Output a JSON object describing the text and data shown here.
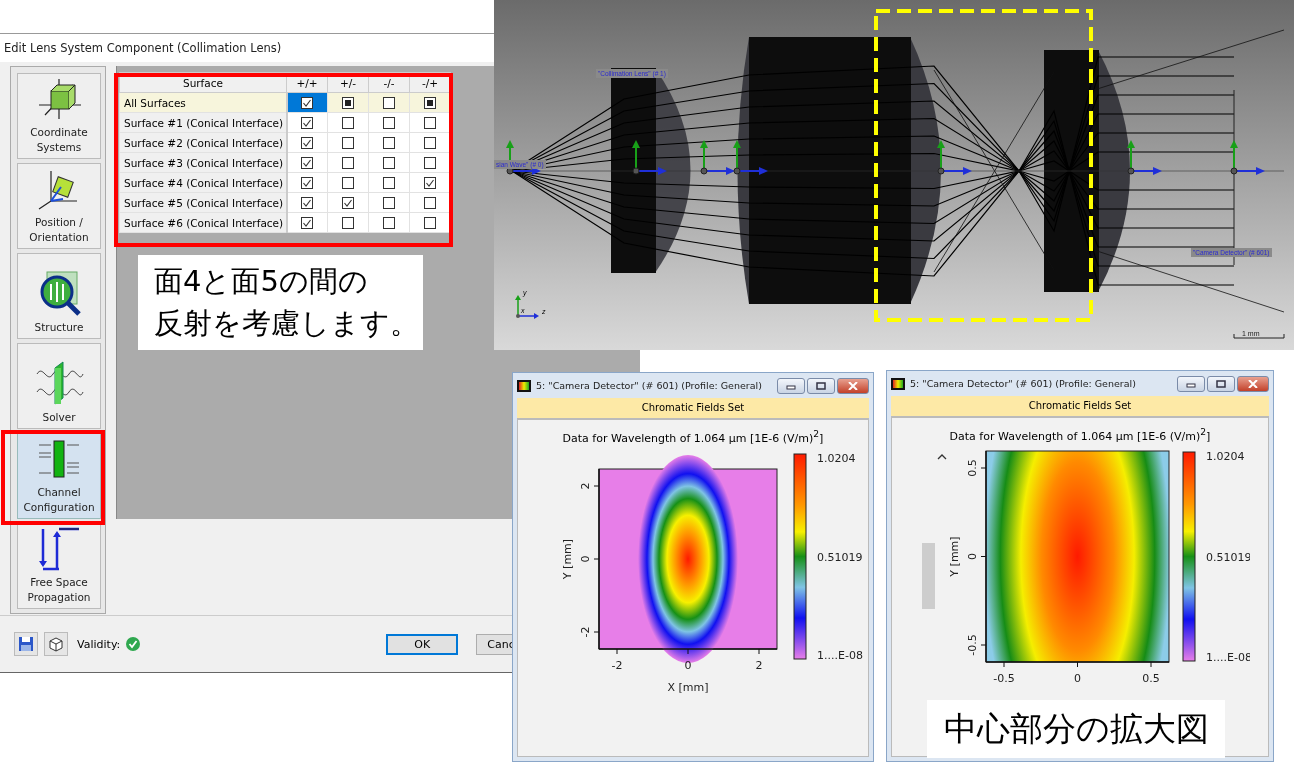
{
  "dialog": {
    "title": "Edit Lens System Component (Collimation Lens)",
    "sidebar": [
      {
        "kind": "coordinates",
        "label": "Coordinate Systems",
        "selected": false
      },
      {
        "kind": "position",
        "label": "Position / Orientation",
        "selected": false
      },
      {
        "kind": "structure",
        "label": "Structure",
        "selected": false
      },
      {
        "kind": "solver",
        "label": "Solver",
        "selected": false
      },
      {
        "kind": "channel",
        "label": "Channel Configuration",
        "selected": true
      },
      {
        "kind": "propagation",
        "label": "Free Space Propagation",
        "selected": false
      }
    ],
    "channel_table": {
      "columns": [
        "Surface",
        "+/+",
        "+/-",
        "-/-",
        "-/+"
      ],
      "rows": [
        {
          "label": "All Surfaces",
          "cells": [
            {
              "checked": true,
              "mixed": false,
              "selected": true
            },
            {
              "checked": false,
              "mixed": true,
              "selected": false
            },
            {
              "checked": false,
              "mixed": false,
              "selected": false
            },
            {
              "checked": false,
              "mixed": true,
              "selected": false
            }
          ]
        },
        {
          "label": "Surface #1 (Conical Interface)",
          "cells": [
            {
              "checked": true,
              "mixed": false,
              "selected": false
            },
            {
              "checked": false,
              "mixed": false,
              "selected": false
            },
            {
              "checked": false,
              "mixed": false,
              "selected": false
            },
            {
              "checked": false,
              "mixed": false,
              "selected": false
            }
          ]
        },
        {
          "label": "Surface #2 (Conical Interface)",
          "cells": [
            {
              "checked": true,
              "mixed": false,
              "selected": false
            },
            {
              "checked": false,
              "mixed": false,
              "selected": false
            },
            {
              "checked": false,
              "mixed": false,
              "selected": false
            },
            {
              "checked": false,
              "mixed": false,
              "selected": false
            }
          ]
        },
        {
          "label": "Surface #3 (Conical Interface)",
          "cells": [
            {
              "checked": true,
              "mixed": false,
              "selected": false
            },
            {
              "checked": false,
              "mixed": false,
              "selected": false
            },
            {
              "checked": false,
              "mixed": false,
              "selected": false
            },
            {
              "checked": false,
              "mixed": false,
              "selected": false
            }
          ]
        },
        {
          "label": "Surface #4 (Conical Interface)",
          "cells": [
            {
              "checked": true,
              "mixed": false,
              "selected": false
            },
            {
              "checked": false,
              "mixed": false,
              "selected": false
            },
            {
              "checked": false,
              "mixed": false,
              "selected": false
            },
            {
              "checked": true,
              "mixed": false,
              "selected": false
            }
          ]
        },
        {
          "label": "Surface #5 (Conical Interface)",
          "cells": [
            {
              "checked": true,
              "mixed": false,
              "selected": false
            },
            {
              "checked": true,
              "mixed": false,
              "selected": false
            },
            {
              "checked": false,
              "mixed": false,
              "selected": false
            },
            {
              "checked": false,
              "mixed": false,
              "selected": false
            }
          ]
        },
        {
          "label": "Surface #6 (Conical Interface)",
          "cells": [
            {
              "checked": true,
              "mixed": false,
              "selected": false
            },
            {
              "checked": false,
              "mixed": false,
              "selected": false
            },
            {
              "checked": false,
              "mixed": false,
              "selected": false
            },
            {
              "checked": false,
              "mixed": false,
              "selected": false
            }
          ]
        }
      ]
    },
    "validity": {
      "label": "Validity:",
      "valid": true
    },
    "buttons": [
      "OK",
      "Canc"
    ]
  },
  "note_reflection": [
    "面4と面5の間の",
    "反射を考慮します。"
  ],
  "view_3d": {
    "component_labels": [
      {
        "kind": "lens",
        "text": "\"Collimation Lens\" (# 1)"
      },
      {
        "kind": "source",
        "text": "sian Wave\" (# 0)"
      },
      {
        "kind": "detector",
        "text": "\"Camera Detector\" (# 601)"
      }
    ],
    "axes": [
      "y",
      "x",
      "z"
    ],
    "scale": "1 mm"
  },
  "detector_windows": [
    {
      "kind": "full",
      "title": "5: \"Camera Detector\" (# 601) (Profile: General)",
      "tab": "Chromatic Fields Set",
      "plot_title": "Data for Wavelength of 1.064 µm  [1E-6 (V/m)$^{2}$]",
      "y_ticks": [
        "2",
        "0",
        "-2"
      ],
      "x_ticks": [
        "-2",
        "0",
        "2"
      ],
      "y_label": "Y [mm]",
      "x_label": "X [mm]",
      "scale_labels": [
        "1.0204",
        "0.51019",
        "1....E-08"
      ],
      "scrollbar": false
    },
    {
      "kind": "zoomed",
      "title": "5: \"Camera Detector\" (# 601) (Profile: General)",
      "tab": "Chromatic Fields Set",
      "plot_title": "Data for Wavelength of 1.064 µm  [1E-6 (V/m)$^{2}$]",
      "y_ticks": [
        "0.5",
        "0",
        "-0.5"
      ],
      "x_ticks": [
        "-0.5",
        "0",
        "0.5"
      ],
      "y_label": "Y [mm]",
      "scale_labels": [
        "1.0204",
        "0.51019",
        "1....E-08"
      ],
      "scrollbar": true
    }
  ],
  "note_zoom": "中心部分の拡大図"
}
